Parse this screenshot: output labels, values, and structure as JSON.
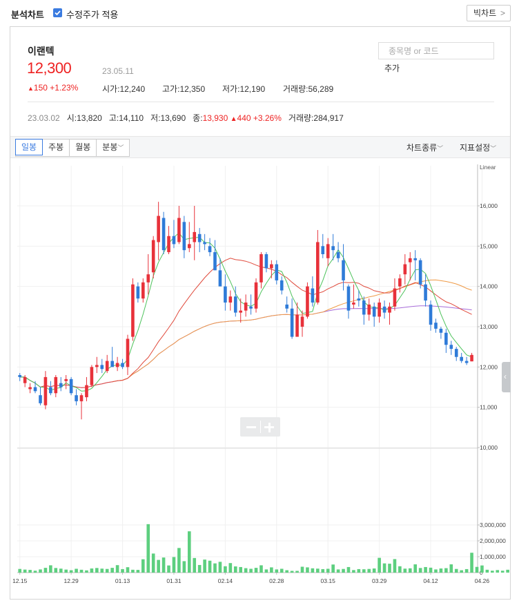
{
  "header": {
    "title": "분석차트",
    "adjusted_label": "수정주가 적용",
    "adjusted_checked": true,
    "bigchart_label": "빅차트",
    "bigchart_chevron": ">"
  },
  "stock": {
    "name": "이랜텍",
    "price": "12,300",
    "date": "23.05.11",
    "change": "150 +1.23%",
    "open_label": "시가",
    "open": "12,240",
    "high_label": "고가",
    "high": "12,350",
    "low_label": "저가",
    "low": "12,190",
    "vol_label": "거래량",
    "vol": "56,289"
  },
  "search": {
    "placeholder": "종목명 or 코드",
    "add_label": "추가"
  },
  "history": {
    "date": "23.03.02",
    "o_label": "시",
    "o": "13,820",
    "h_label": "고",
    "h": "14,110",
    "l_label": "저",
    "l": "13,690",
    "c_label": "종",
    "c": "13,930",
    "chg": "440 +3.26%",
    "v_label": "거래량",
    "v": "284,917"
  },
  "toolbar": {
    "tabs": [
      "일봉",
      "주봉",
      "월봉",
      "분봉"
    ],
    "active_tab": "일봉",
    "chart_type_label": "차트종류",
    "indicator_label": "지표설정"
  },
  "colors": {
    "up": "#e8313a",
    "down": "#2f7bd8",
    "volume": "#5dcf7f",
    "ma5": "#4cc25a",
    "ma20": "#e04a3c",
    "ma60": "#ef9a46",
    "ma120": "#a66ad8",
    "accent": "#3a7be0"
  },
  "chart_data": {
    "type": "candlestick",
    "scale_label": "Linear",
    "price_axis": {
      "ticks": [
        10000,
        11000,
        12000,
        13000,
        14000,
        15000,
        16000
      ],
      "tick_labels": [
        "10,000",
        "11,000",
        "12,000",
        "13,000",
        "14,000",
        "15,000",
        "16,000"
      ],
      "ylim": [
        10000,
        17000
      ]
    },
    "volume_axis": {
      "ticks": [
        0,
        1000000,
        2000000,
        3000000
      ],
      "tick_labels": [
        "0",
        "1,000,000",
        "2,000,000",
        "3,000,000"
      ],
      "ylim": [
        0,
        3000000
      ]
    },
    "x_tick_labels": [
      "12.15",
      "12.29",
      "01.13",
      "01.31",
      "02.14",
      "02.28",
      "03.15",
      "03.29",
      "04.12",
      "04.26"
    ],
    "x_tick_index": [
      0,
      10,
      20,
      30,
      40,
      50,
      60,
      70,
      80,
      90
    ],
    "candles": [
      [
        11800,
        11850,
        11650,
        11750
      ],
      [
        11600,
        11800,
        11500,
        11750
      ],
      [
        11450,
        11600,
        11350,
        11500
      ],
      [
        11500,
        11650,
        11350,
        11400
      ],
      [
        11300,
        11500,
        11050,
        11100
      ],
      [
        11050,
        11900,
        10950,
        11750
      ],
      [
        11500,
        11650,
        11300,
        11350
      ],
      [
        11350,
        11800,
        11250,
        11750
      ],
      [
        11600,
        11750,
        11400,
        11500
      ],
      [
        11650,
        11800,
        11450,
        11700
      ],
      [
        11700,
        11750,
        11300,
        11350
      ],
      [
        11300,
        11450,
        11050,
        11150
      ],
      [
        11150,
        11350,
        10700,
        11300
      ],
      [
        11250,
        11750,
        11150,
        11550
      ],
      [
        11550,
        12050,
        11500,
        12000
      ],
      [
        12000,
        12250,
        11850,
        12050
      ],
      [
        12050,
        12200,
        11850,
        11950
      ],
      [
        11900,
        12300,
        11850,
        12150
      ],
      [
        12150,
        12500,
        12050,
        12000
      ],
      [
        12000,
        12250,
        11900,
        12100
      ],
      [
        12100,
        12200,
        11950,
        12000
      ],
      [
        12000,
        12800,
        11800,
        12700
      ],
      [
        12750,
        14200,
        12650,
        14050
      ],
      [
        14000,
        14100,
        13600,
        13700
      ],
      [
        13700,
        14200,
        13600,
        14100
      ],
      [
        14100,
        14800,
        13800,
        14300
      ],
      [
        14350,
        15250,
        14200,
        15150
      ],
      [
        15100,
        16100,
        14650,
        15750
      ],
      [
        15700,
        15850,
        14800,
        14900
      ],
      [
        14850,
        15500,
        14800,
        15250
      ],
      [
        15250,
        15650,
        14950,
        15050
      ],
      [
        15100,
        16000,
        15050,
        15700
      ],
      [
        15600,
        15750,
        14700,
        14900
      ],
      [
        14950,
        15600,
        14850,
        15050
      ],
      [
        15100,
        16000,
        14650,
        15350
      ],
      [
        15300,
        15450,
        14850,
        15100
      ],
      [
        15100,
        15300,
        14900,
        15050
      ],
      [
        15000,
        15200,
        14750,
        14850
      ],
      [
        14850,
        15150,
        14650,
        14400
      ],
      [
        14400,
        14700,
        14050,
        14000
      ],
      [
        14000,
        14300,
        13400,
        13600
      ],
      [
        13600,
        13900,
        13400,
        13750
      ],
      [
        13750,
        14000,
        13250,
        13350
      ],
      [
        13350,
        13700,
        13100,
        13400
      ],
      [
        13400,
        13800,
        13250,
        13600
      ],
      [
        13500,
        13800,
        13300,
        13450
      ],
      [
        13450,
        14200,
        13350,
        14100
      ],
      [
        14100,
        14850,
        13950,
        14800
      ],
      [
        14800,
        14850,
        14350,
        14450
      ],
      [
        14450,
        14650,
        14200,
        14550
      ],
      [
        14550,
        14650,
        14050,
        14150
      ],
      [
        14150,
        14250,
        13800,
        13900
      ],
      [
        13550,
        13750,
        13350,
        13450
      ],
      [
        13450,
        13700,
        12700,
        12750
      ],
      [
        12750,
        13600,
        12850,
        13300
      ],
      [
        13000,
        13400,
        12750,
        13250
      ],
      [
        13250,
        14100,
        13200,
        14000
      ],
      [
        13950,
        14250,
        13500,
        13600
      ],
      [
        13600,
        15400,
        13550,
        15100
      ],
      [
        15000,
        15300,
        14700,
        14800
      ],
      [
        14700,
        15200,
        14500,
        15050
      ],
      [
        15000,
        15300,
        14650,
        14900
      ],
      [
        14850,
        15100,
        14600,
        14700
      ],
      [
        14650,
        15050,
        13900,
        14150
      ],
      [
        14000,
        14050,
        13200,
        13400
      ],
      [
        13550,
        14050,
        13450,
        13600
      ],
      [
        13700,
        13900,
        13500,
        13650
      ],
      [
        13650,
        13750,
        13050,
        13300
      ],
      [
        13300,
        13700,
        13150,
        13550
      ],
      [
        13500,
        13600,
        13000,
        13250
      ],
      [
        13250,
        13700,
        13100,
        13600
      ],
      [
        13500,
        13650,
        13200,
        13350
      ],
      [
        13350,
        13600,
        13050,
        13500
      ],
      [
        13500,
        14200,
        13400,
        13950
      ],
      [
        14000,
        14300,
        13850,
        14200
      ],
      [
        14300,
        14800,
        14050,
        14550
      ],
      [
        14600,
        14850,
        14150,
        14700
      ],
      [
        14700,
        14900,
        14150,
        14650
      ],
      [
        14650,
        14700,
        13950,
        14050
      ],
      [
        14050,
        14300,
        13500,
        13650
      ],
      [
        13550,
        13650,
        12900,
        13050
      ],
      [
        13100,
        13200,
        12850,
        12950
      ],
      [
        12950,
        13000,
        12700,
        12850
      ],
      [
        12850,
        12950,
        12350,
        12550
      ],
      [
        12550,
        12650,
        12300,
        12450
      ],
      [
        12450,
        12500,
        12150,
        12250
      ],
      [
        12250,
        12350,
        12100,
        12150
      ],
      [
        12150,
        12250,
        12050,
        12100
      ],
      [
        12140,
        12350,
        12140,
        12300
      ]
    ],
    "volumes": [
      230000,
      190000,
      170000,
      120000,
      200000,
      300000,
      460000,
      290000,
      250000,
      190000,
      150000,
      240000,
      180000,
      140000,
      260000,
      290000,
      250000,
      230000,
      300000,
      470000,
      220000,
      340000,
      180000,
      170000,
      840000,
      3050000,
      1200000,
      800000,
      950000,
      450000,
      980000,
      1550000,
      720000,
      2600000,
      920000,
      480000,
      820000,
      750000,
      580000,
      680000,
      400000,
      600000,
      390000,
      350000,
      280000,
      240000,
      300000,
      460000,
      200000,
      330000,
      200000,
      240000,
      150000,
      110000,
      110000,
      370000,
      330000,
      270000,
      250000,
      220000,
      240000,
      510000,
      200000,
      230000,
      350000,
      160000,
      220000,
      210000,
      230000,
      260000,
      930000,
      580000,
      560000,
      850000,
      400000,
      250000,
      270000,
      520000,
      290000,
      350000,
      310000,
      200000,
      260000,
      280000,
      520000,
      230000,
      150000,
      220000,
      1250000,
      360000,
      450000,
      180000,
      120000,
      160000,
      120000,
      180000,
      130000,
      100000,
      80000,
      60000
    ]
  }
}
